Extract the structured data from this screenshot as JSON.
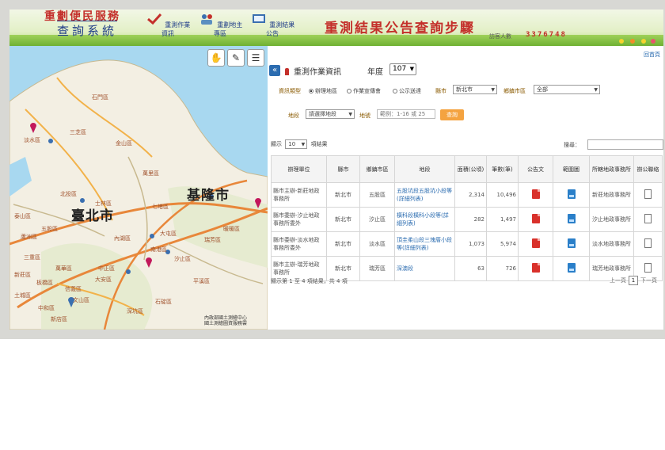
{
  "header": {
    "logo_title": "重劃便民服務",
    "logo_subtitle": "查詢系統",
    "nav": [
      {
        "label": "重測作業資訊"
      },
      {
        "label": "重劃地主專區"
      },
      {
        "label": "重測結果公告"
      }
    ],
    "page_heading": "重測結果公告查詢步驟",
    "visitor_label": "訪客人數",
    "visitor_count": "3376748"
  },
  "map": {
    "tools": [
      {
        "icon": "pan-hand-icon"
      },
      {
        "icon": "draw-pen-icon"
      },
      {
        "icon": "layers-icon"
      }
    ],
    "big_labels": {
      "taipei": "臺北市",
      "keelung": "基隆市"
    },
    "labels": {
      "shimen": "石門區",
      "sanzhi": "三芝區",
      "jinshan": "金山區",
      "tamsui": "淡水區",
      "wanli": "萬里區",
      "beitou": "北投區",
      "shilin": "士林區",
      "qidu": "七堵區",
      "neihu": "內湖區",
      "nangang": "南港區",
      "xizhi": "汐止區",
      "banqiao": "板橋區",
      "xindian": "新店區",
      "wenshan": "文山區",
      "shenkeng": "深坑區",
      "pingxi": "平溪區",
      "ruifang": "瑞芳區",
      "zhonghe": "中和區",
      "xinyi": "信義區",
      "daan": "大安區",
      "zhongzheng": "中正區",
      "nuannuan": "暖暖區",
      "shiding": "石碇區",
      "dadu": "大屯區",
      "wugu": "五股區",
      "luzhou": "蘆洲區",
      "sanchong": "三重區",
      "wanhua": "萬華區",
      "tucheng": "土城區",
      "taishan": "泰山區",
      "xinzhuang": "新莊區"
    },
    "credit_line1": "內政部國土測繪中心",
    "credit_line2": "國土測繪圖資服務雲"
  },
  "panel": {
    "back_link": "回首頁",
    "collapse_glyph": "«",
    "title": "重測作業資訊",
    "year_label": "年度",
    "year_value": "107",
    "filters": {
      "type_label": "資訊類型",
      "radio_options": [
        "辦理地區",
        "作業宣傳會",
        "公示送達"
      ],
      "county_label": "縣市",
      "county_value": "新北市",
      "district_label": "鄉鎮市區",
      "district_value": "全部",
      "section_label": "地段",
      "section_value": "請選擇地段",
      "lot_label": "地號",
      "lot_placeholder": "範例：1-16 或 25",
      "query_button": "查詢"
    },
    "show_prefix": "顯示",
    "show_value": "10",
    "show_suffix": "項結果",
    "search_label": "搜尋：",
    "table": {
      "headers": [
        "辦理單位",
        "縣市",
        "鄉鎮市區",
        "地段",
        "面積(公頃)",
        "筆數(筆)",
        "公告文",
        "範圍圖",
        "所轄地政事務所",
        "辦公聯絡"
      ],
      "rows": [
        {
          "unit": "縣市主辦-新莊地政事務所",
          "county": "新北市",
          "district": "五股區",
          "section": "五股坑段五股坑小段等(詳細列表)",
          "area": "2,314",
          "count": "10,496",
          "office": "新莊地政事務所"
        },
        {
          "unit": "縣市委辦-汐止地政事務所委外",
          "county": "新北市",
          "district": "汐止區",
          "section": "橫科段橫科小段等(詳細列表)",
          "area": "282",
          "count": "1,497",
          "office": "汐止地政事務所"
        },
        {
          "unit": "縣市委辦-淡水地政事務所委外",
          "county": "新北市",
          "district": "淡水區",
          "section": "頂圭柔山段三塊厝小段等(詳細列表)",
          "area": "1,073",
          "count": "5,974",
          "office": "淡水地政事務所"
        },
        {
          "unit": "縣市主辦-瑞芳地政事務所",
          "county": "新北市",
          "district": "瑞芳區",
          "section": "深澳段",
          "area": "63",
          "count": "726",
          "office": "瑞芳地政事務所"
        }
      ]
    },
    "footer_info": "顯示第 1 至 4 項結果，共 4 項",
    "pager": {
      "prev": "上一頁",
      "current": "1",
      "next": "下一頁"
    }
  },
  "colors": {
    "brand_red": "#c4302b",
    "link_blue": "#2b6cb0",
    "query_orange": "#f4a340",
    "map_sea": "#a8d8f0",
    "map_land": "#f3efe3"
  }
}
